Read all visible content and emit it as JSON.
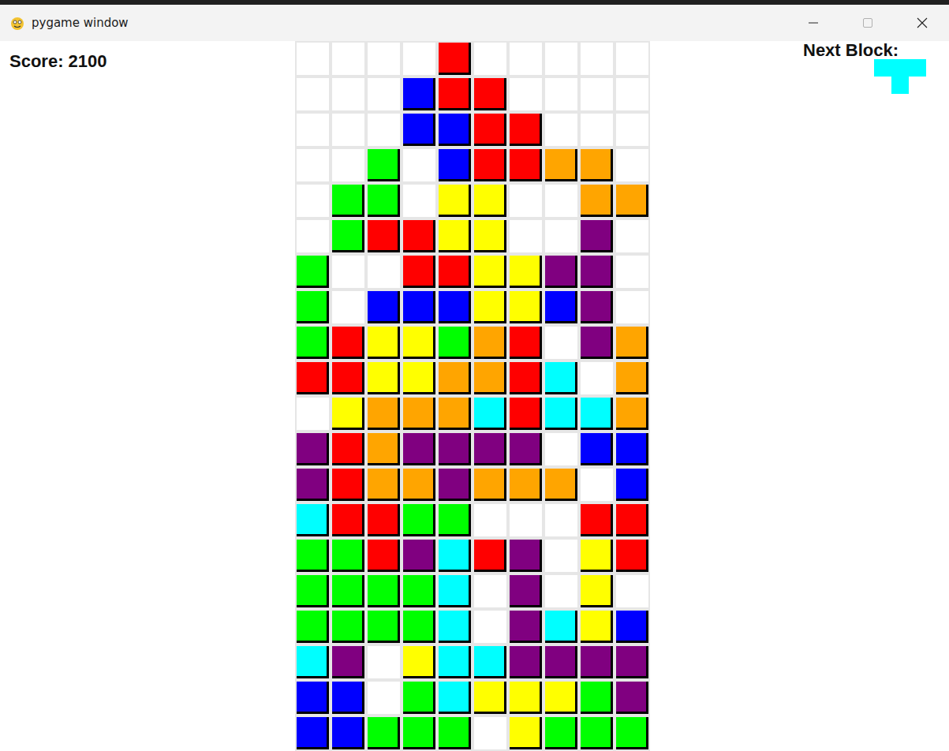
{
  "window": {
    "title": "pygame window"
  },
  "score": {
    "label": "Score: 2100"
  },
  "next_block": {
    "label": "Next Block:",
    "color": "#00ffff",
    "shape": [
      [
        true,
        true,
        true
      ],
      [
        false,
        true,
        false
      ]
    ]
  },
  "board": {
    "rows": [
      [
        null,
        null,
        null,
        null,
        "#ff0000",
        null,
        null,
        null,
        null,
        null
      ],
      [
        null,
        null,
        null,
        "#0000ff",
        "#ff0000",
        "#ff0000",
        null,
        null,
        null,
        null
      ],
      [
        null,
        null,
        null,
        "#0000ff",
        "#0000ff",
        "#ff0000",
        "#ff0000",
        null,
        null,
        null
      ],
      [
        null,
        null,
        "#00ff00",
        null,
        "#0000ff",
        "#ff0000",
        "#ff0000",
        "#ffa500",
        "#ffa500",
        null
      ],
      [
        null,
        "#00ff00",
        "#00ff00",
        null,
        "#ffff00",
        "#ffff00",
        null,
        null,
        "#ffa500",
        "#ffa500"
      ],
      [
        null,
        "#00ff00",
        "#ff0000",
        "#ff0000",
        "#ffff00",
        "#ffff00",
        null,
        null,
        "#800080",
        null
      ],
      [
        "#00ff00",
        null,
        null,
        "#ff0000",
        "#ff0000",
        "#ffff00",
        "#ffff00",
        "#800080",
        "#800080",
        null
      ],
      [
        "#00ff00",
        null,
        "#0000ff",
        "#0000ff",
        "#0000ff",
        "#ffff00",
        "#ffff00",
        "#0000ff",
        "#800080",
        null
      ],
      [
        "#00ff00",
        "#ff0000",
        "#ffff00",
        "#ffff00",
        "#00ff00",
        "#ffa500",
        "#ff0000",
        null,
        "#800080",
        "#ffa500"
      ],
      [
        "#ff0000",
        "#ff0000",
        "#ffff00",
        "#ffff00",
        "#ffa500",
        "#ffa500",
        "#ff0000",
        "#00ffff",
        null,
        "#ffa500"
      ],
      [
        null,
        "#ffff00",
        "#ffa500",
        "#ffa500",
        "#ffa500",
        "#00ffff",
        "#ff0000",
        "#00ffff",
        "#00ffff",
        "#ffa500"
      ],
      [
        "#800080",
        "#ff0000",
        "#ffa500",
        "#800080",
        "#800080",
        "#800080",
        "#800080",
        null,
        "#0000ff",
        "#0000ff"
      ],
      [
        "#800080",
        "#ff0000",
        "#ffa500",
        "#ffa500",
        "#800080",
        "#ffa500",
        "#ffa500",
        "#ffa500",
        null,
        "#0000ff"
      ],
      [
        "#00ffff",
        "#ff0000",
        "#ff0000",
        "#00ff00",
        "#00ff00",
        null,
        null,
        null,
        "#ff0000",
        "#ff0000"
      ],
      [
        "#00ff00",
        "#00ff00",
        "#ff0000",
        "#800080",
        "#00ffff",
        "#ff0000",
        "#800080",
        null,
        "#ffff00",
        "#ff0000"
      ],
      [
        "#00ff00",
        "#00ff00",
        "#00ff00",
        "#00ff00",
        "#00ffff",
        null,
        "#800080",
        null,
        "#ffff00",
        null
      ],
      [
        "#00ff00",
        "#00ff00",
        "#00ff00",
        "#00ff00",
        "#00ffff",
        null,
        "#800080",
        "#00ffff",
        "#ffff00",
        "#0000ff"
      ],
      [
        "#00ffff",
        "#800080",
        null,
        "#ffff00",
        "#00ffff",
        "#00ffff",
        "#800080",
        "#800080",
        "#800080",
        "#800080"
      ],
      [
        "#0000ff",
        "#0000ff",
        null,
        "#00ff00",
        "#00ffff",
        "#ffff00",
        "#ffff00",
        "#ffff00",
        "#00ff00",
        "#800080"
      ],
      [
        "#0000ff",
        "#0000ff",
        "#00ff00",
        "#00ff00",
        "#00ff00",
        null,
        "#ffff00",
        "#00ff00",
        "#00ff00",
        "#00ff00"
      ]
    ]
  }
}
